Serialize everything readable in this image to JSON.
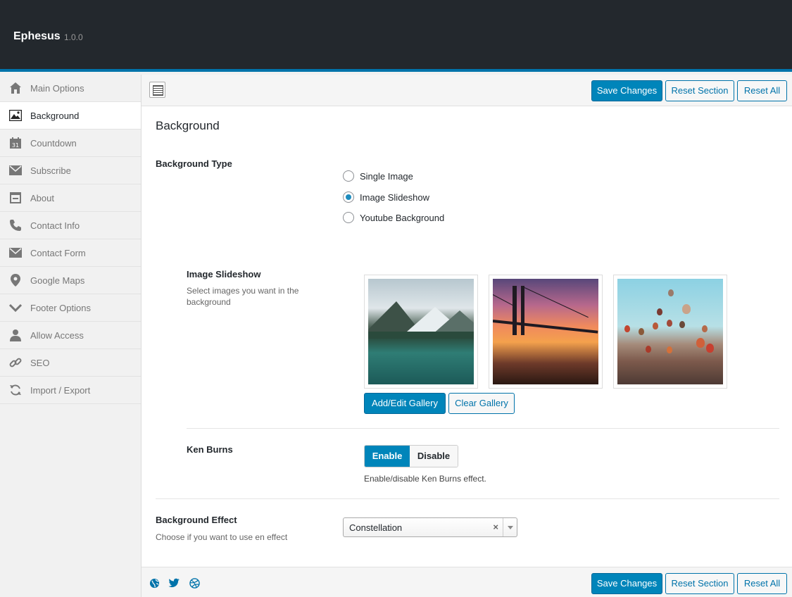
{
  "app": {
    "title": "Ephesus",
    "version": "1.0.0"
  },
  "sidebar": {
    "items": [
      {
        "label": "Main Options",
        "icon": "home-icon"
      },
      {
        "label": "Background",
        "icon": "image-icon",
        "active": true
      },
      {
        "label": "Countdown",
        "icon": "calendar-icon"
      },
      {
        "label": "Subscribe",
        "icon": "envelope-icon"
      },
      {
        "label": "About",
        "icon": "window-icon"
      },
      {
        "label": "Contact Info",
        "icon": "phone-icon"
      },
      {
        "label": "Contact Form",
        "icon": "envelope-icon"
      },
      {
        "label": "Google Maps",
        "icon": "map-marker-icon"
      },
      {
        "label": "Footer Options",
        "icon": "chevron-down-icon"
      },
      {
        "label": "Allow Access",
        "icon": "user-icon"
      },
      {
        "label": "SEO",
        "icon": "link-icon"
      },
      {
        "label": "Import / Export",
        "icon": "refresh-icon"
      }
    ]
  },
  "toolbar": {
    "save": "Save Changes",
    "reset_section": "Reset Section",
    "reset_all": "Reset All"
  },
  "section": {
    "title": "Background"
  },
  "background_type": {
    "label": "Background Type",
    "options": [
      "Single Image",
      "Image Slideshow",
      "Youtube Background"
    ],
    "selected": "Image Slideshow"
  },
  "slideshow": {
    "label": "Image Slideshow",
    "description": "Select images you want in the background",
    "images": [
      "mountain-lake-image",
      "bridge-sunset-image",
      "hot-air-balloons-image"
    ],
    "add_button": "Add/Edit Gallery",
    "clear_button": "Clear Gallery"
  },
  "ken_burns": {
    "label": "Ken Burns",
    "enable": "Enable",
    "disable": "Disable",
    "selected": "Enable",
    "description": "Enable/disable Ken Burns effect."
  },
  "background_effect": {
    "label": "Background Effect",
    "description": "Choose if you want to use en effect",
    "value": "Constellation",
    "clear": "×"
  },
  "footer": {
    "icons": [
      "globe-icon",
      "twitter-icon",
      "dribbble-icon"
    ]
  },
  "colors": {
    "accent": "#0085ba",
    "dark": "#23282d",
    "topbar_border": "#0073aa"
  }
}
